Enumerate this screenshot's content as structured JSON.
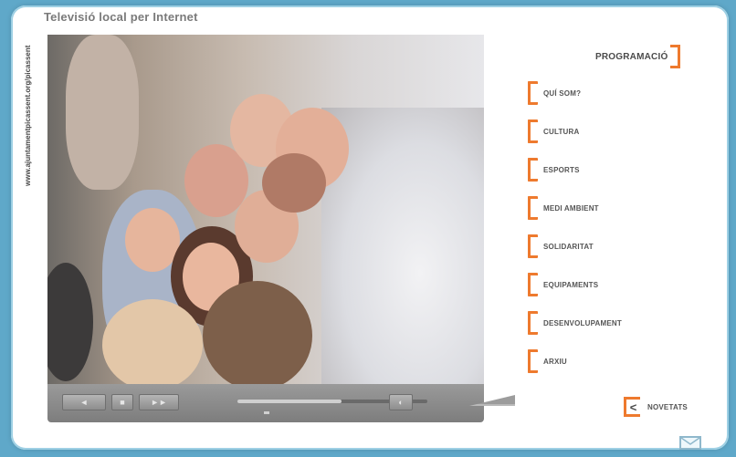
{
  "header": {
    "title": "Televisió local per Internet",
    "side_url": "www.ajuntamentpicassent.org/picassent"
  },
  "player": {
    "buttons": {
      "rewind": "◄",
      "play": "■",
      "forward": "►►",
      "volume": "◐"
    },
    "progress": 0.55
  },
  "menu": {
    "programacio": "PROGRAMACIÓ",
    "items": [
      {
        "label": "QUÍ SOM?"
      },
      {
        "label": "CULTURA"
      },
      {
        "label": "ESPORTS"
      },
      {
        "label": "MEDI AMBIENT"
      },
      {
        "label": "SOLIDARITAT"
      },
      {
        "label": "EQUIPAMENTS"
      },
      {
        "label": "DESENVOLUPAMENT"
      },
      {
        "label": "ARXIU"
      }
    ],
    "novetats": "NOVETATS",
    "novetats_arrow": "<"
  },
  "colors": {
    "accent": "#ee7a2e",
    "background": "#5fa8c9"
  }
}
